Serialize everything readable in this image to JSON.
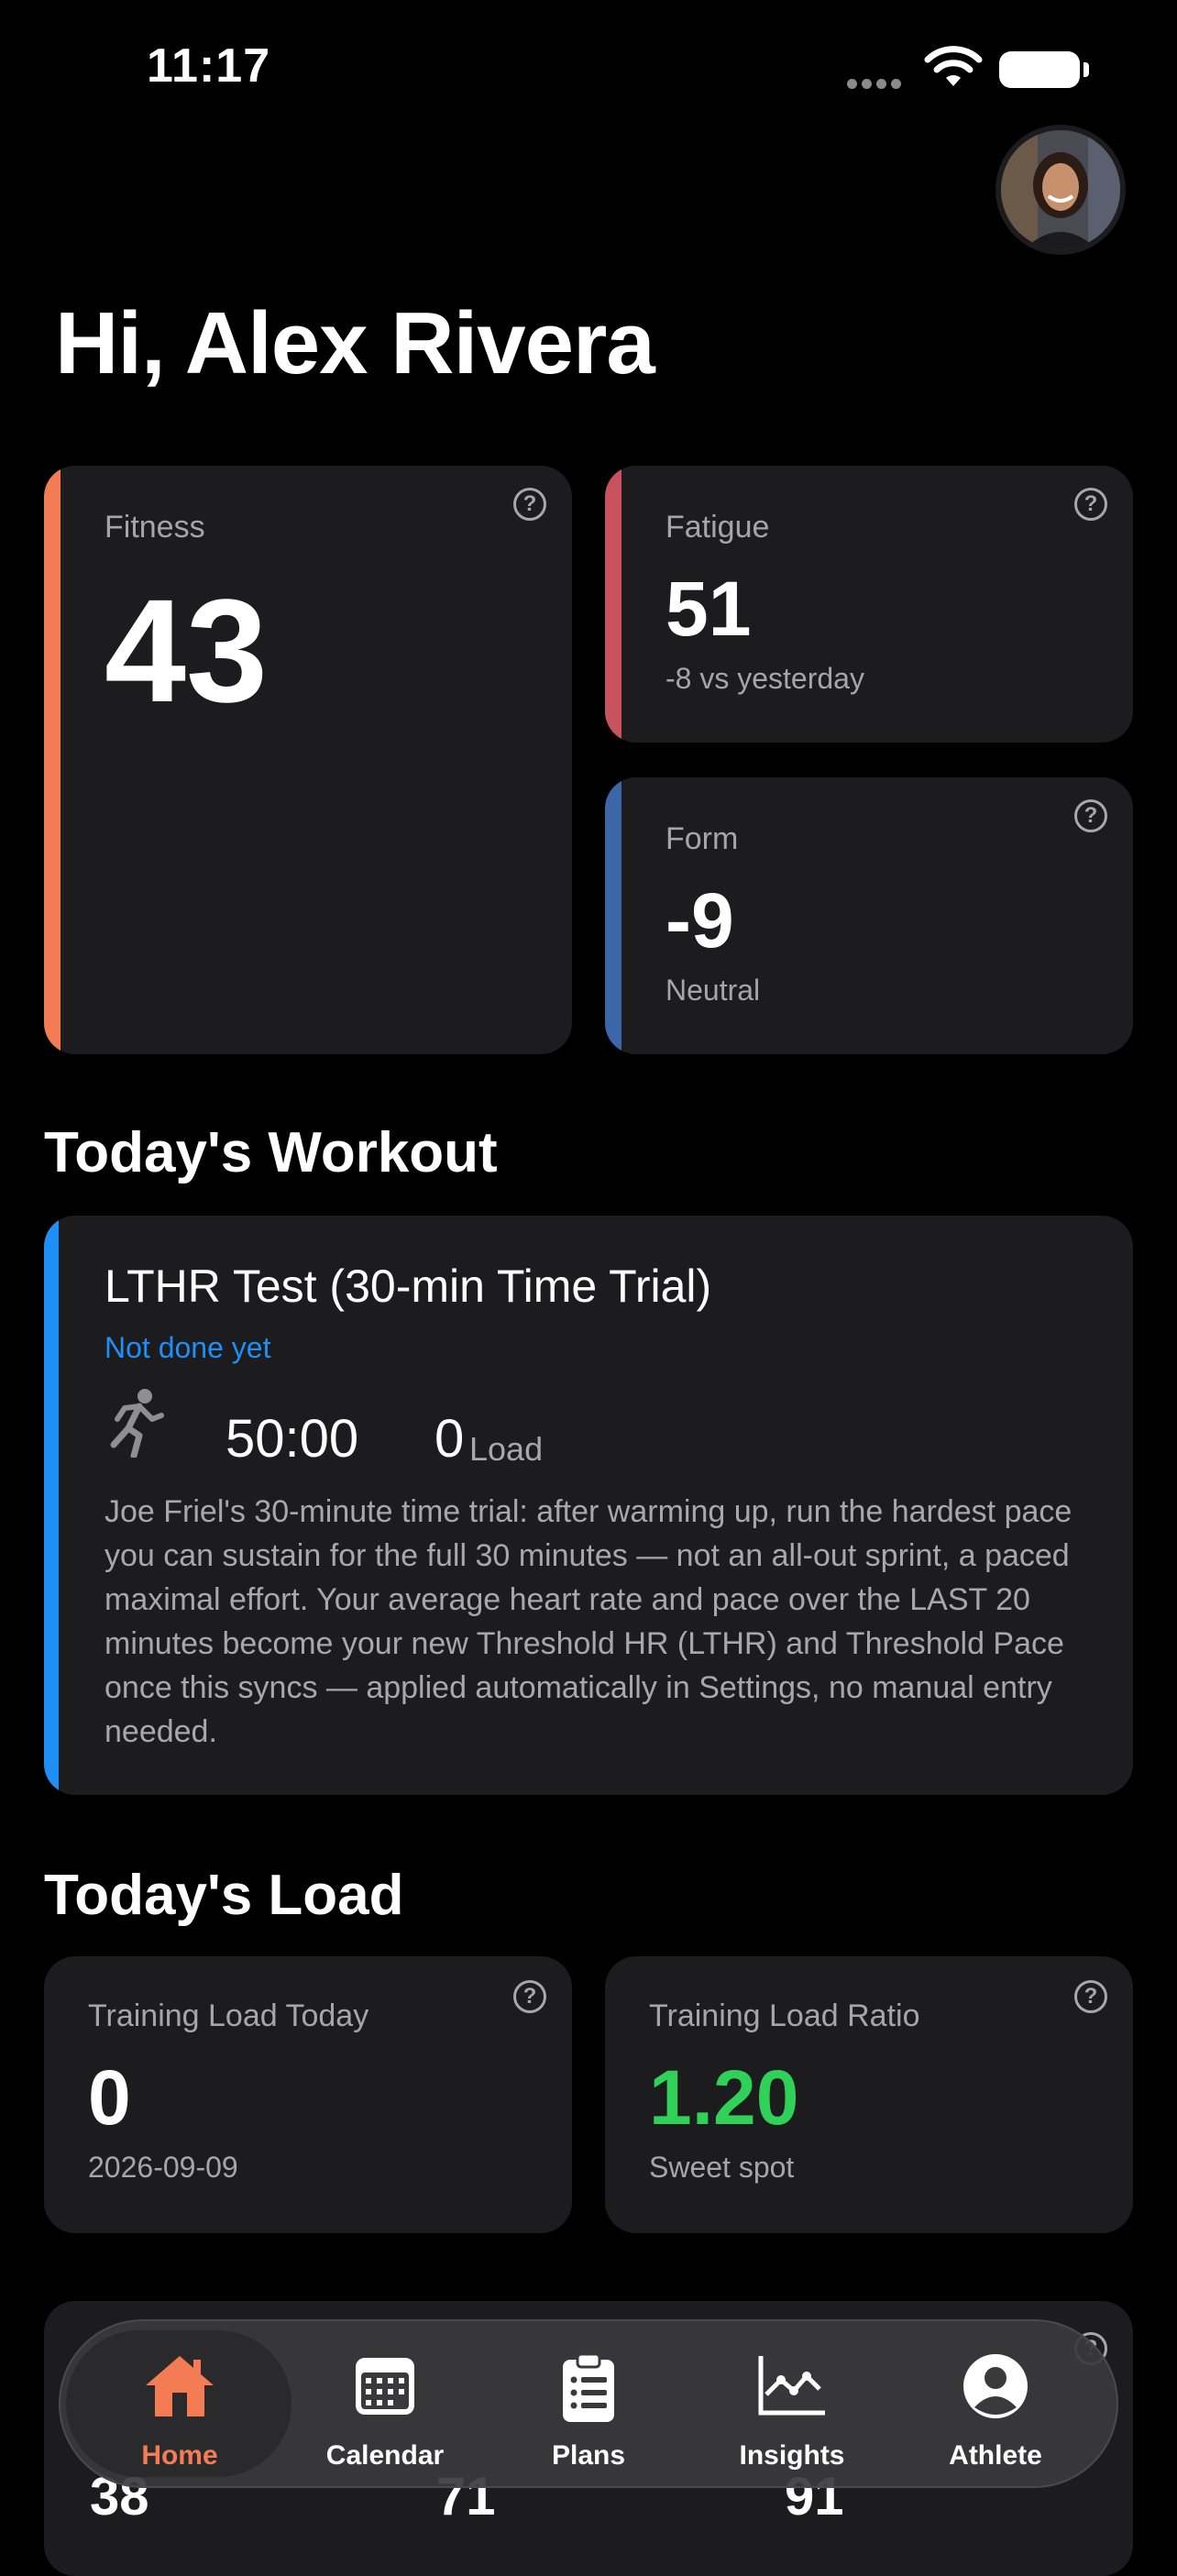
{
  "status_bar": {
    "time": "11:17"
  },
  "greeting": "Hi, Alex Rivera",
  "metrics": {
    "fitness": {
      "label": "Fitness",
      "value": "43",
      "color": "#f47c55"
    },
    "fatigue": {
      "label": "Fatigue",
      "value": "51",
      "sub": "-8 vs yesterday",
      "color": "#c8535f"
    },
    "form": {
      "label": "Form",
      "value": "-9",
      "sub": "Neutral",
      "color": "#3d66a8"
    }
  },
  "workout_section": {
    "title": "Today's Workout",
    "name": "LTHR Test (30-min Time Trial)",
    "status": "Not done yet",
    "duration": "50:00",
    "load_value": "0",
    "load_label": "Load",
    "description": "Joe Friel's 30-minute time trial: after warming up, run the hardest pace you can sustain for the full 30 minutes — not an all-out sprint, a paced maximal effort. Your average heart rate and pace over the LAST 20 minutes become your new Threshold HR (LTHR) and Threshold Pace once this syncs — applied automatically in Settings, no manual entry needed.",
    "accent_color": "#1e8ff7"
  },
  "load_section": {
    "title": "Today's Load",
    "training_load": {
      "label": "Training Load Today",
      "value": "0",
      "sub": "2026-09-09"
    },
    "load_ratio": {
      "label": "Training Load Ratio",
      "value": "1.20",
      "sub": "Sweet spot",
      "value_color": "#30d158"
    }
  },
  "partial_row": {
    "values": [
      "38",
      "71",
      "91"
    ]
  },
  "tabs": [
    {
      "label": "Home",
      "icon": "house-icon",
      "active": true
    },
    {
      "label": "Calendar",
      "icon": "calendar-icon"
    },
    {
      "label": "Plans",
      "icon": "clipboard-icon"
    },
    {
      "label": "Insights",
      "icon": "chart-line-icon"
    },
    {
      "label": "Athlete",
      "icon": "person-circle-icon"
    }
  ],
  "help_glyph": "?",
  "accent_active_tab": "#f47c55"
}
